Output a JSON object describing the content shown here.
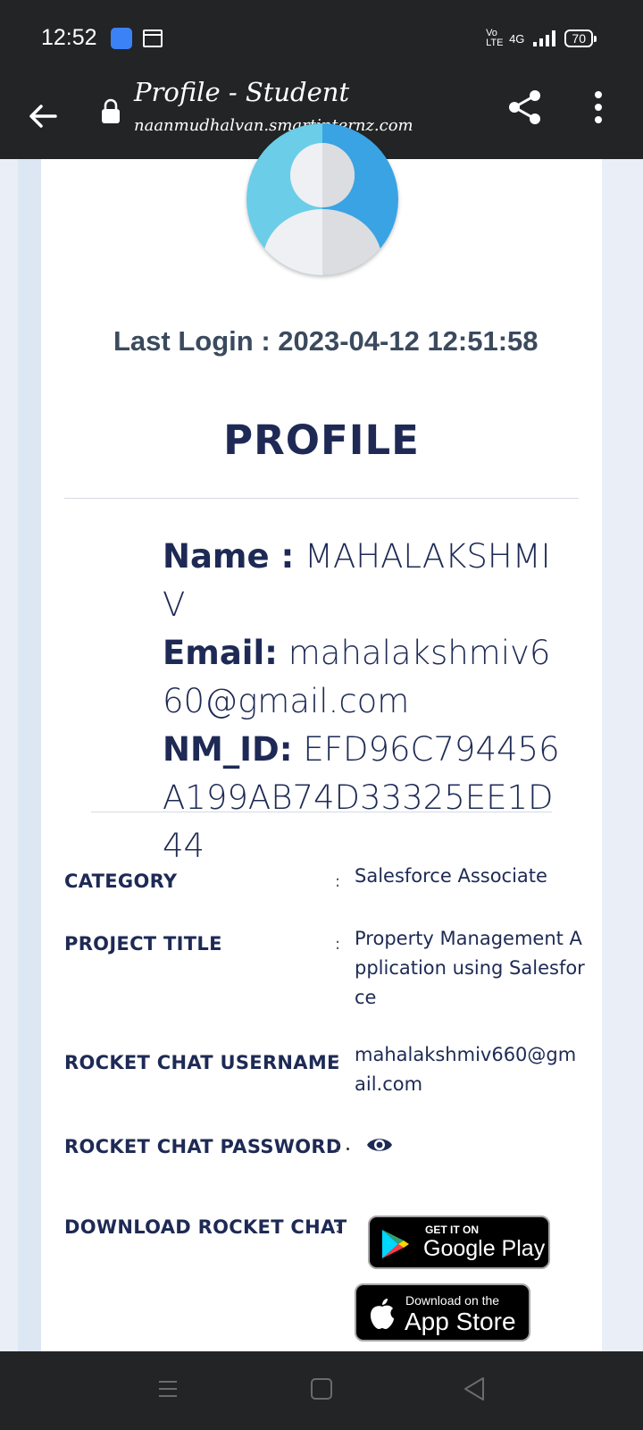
{
  "status_bar": {
    "time": "12:52",
    "network": "4G",
    "volte": "Vo LTE",
    "battery": "70"
  },
  "app_bar": {
    "title": "Profile - Student",
    "url": "naanmudhalvan.smartinternz.com"
  },
  "profile": {
    "last_login": "Last Login : 2023-04-12 12:51:58",
    "heading": "PROFILE",
    "name_label": "Name :",
    "name_value": "MAHALAKSHMI V",
    "email_label": "Email:",
    "email_value": "mahalakshmiv660@gmail.com",
    "nmid_label": "NM_ID:",
    "nmid_value": "EFD96C794456A199AB74D33325EE1D44"
  },
  "details": [
    {
      "label": "CATEGORY",
      "value": "Salesforce Associate"
    },
    {
      "label": "PROJECT TITLE",
      "value": "Property Management Application using Salesforce"
    },
    {
      "label": "ROCKET CHAT USERNAME",
      "value": "mahalakshmiv660@gmail.com"
    },
    {
      "label": "ROCKET CHAT PASSWORD",
      "value": ""
    },
    {
      "label": "DOWNLOAD ROCKET CHAT",
      "value": ""
    }
  ],
  "colon": ":",
  "badges": {
    "google_small": "GET IT ON",
    "google_big": "Google Play",
    "apple_small": "Download on the",
    "apple_big": "App Store"
  },
  "colors": {
    "navy": "#1e2a55",
    "bar": "#232426",
    "avatar_blue": "#3aa3e3"
  },
  "icons": [
    "back-arrow-icon",
    "lock-icon",
    "share-icon",
    "more-vert-icon",
    "eye-icon",
    "google-play-icon",
    "apple-icon",
    "nav-menu-icon",
    "nav-home-icon",
    "nav-back-icon"
  ]
}
